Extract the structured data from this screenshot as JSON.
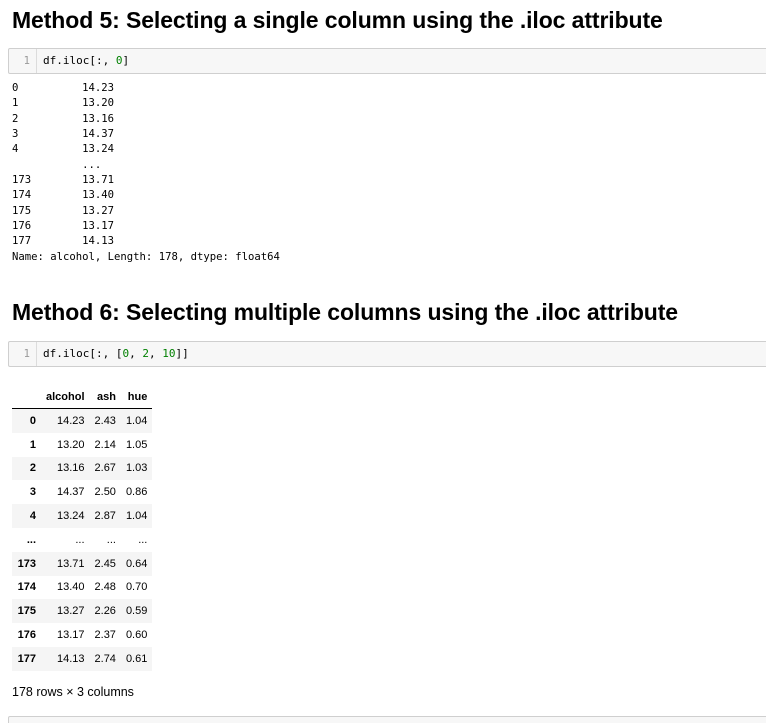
{
  "section5": {
    "title": "Method 5: Selecting a single column using the .iloc attribute",
    "cell": {
      "line_number": "1",
      "code_prefix": "df.iloc[:, ",
      "code_arg": "0",
      "code_suffix": "]"
    },
    "output": {
      "rows": [
        {
          "index": "0",
          "value": "14.23"
        },
        {
          "index": "1",
          "value": "13.20"
        },
        {
          "index": "2",
          "value": "13.16"
        },
        {
          "index": "3",
          "value": "14.37"
        },
        {
          "index": "4",
          "value": "13.24"
        },
        {
          "index": "",
          "value": "..."
        },
        {
          "index": "173",
          "value": "13.71"
        },
        {
          "index": "174",
          "value": "13.40"
        },
        {
          "index": "175",
          "value": "13.27"
        },
        {
          "index": "176",
          "value": "13.17"
        },
        {
          "index": "177",
          "value": "14.13"
        }
      ],
      "footer": "Name: alcohol, Length: 178, dtype: float64"
    }
  },
  "section6": {
    "title": "Method 6: Selecting multiple columns using the .iloc attribute",
    "cell": {
      "line_number": "1",
      "code_prefix": "df.iloc[:, [",
      "arg1": "0",
      "sep1": ", ",
      "arg2": "2",
      "sep2": ", ",
      "arg3": "10",
      "code_suffix": "]]"
    },
    "table": {
      "columns": [
        "alcohol",
        "ash",
        "hue"
      ],
      "rows": [
        {
          "index": "0",
          "alcohol": "14.23",
          "ash": "2.43",
          "hue": "1.04"
        },
        {
          "index": "1",
          "alcohol": "13.20",
          "ash": "2.14",
          "hue": "1.05"
        },
        {
          "index": "2",
          "alcohol": "13.16",
          "ash": "2.67",
          "hue": "1.03"
        },
        {
          "index": "3",
          "alcohol": "14.37",
          "ash": "2.50",
          "hue": "0.86"
        },
        {
          "index": "4",
          "alcohol": "13.24",
          "ash": "2.87",
          "hue": "1.04"
        },
        {
          "index": "...",
          "alcohol": "...",
          "ash": "...",
          "hue": "..."
        },
        {
          "index": "173",
          "alcohol": "13.71",
          "ash": "2.45",
          "hue": "0.64"
        },
        {
          "index": "174",
          "alcohol": "13.40",
          "ash": "2.48",
          "hue": "0.70"
        },
        {
          "index": "175",
          "alcohol": "13.27",
          "ash": "2.26",
          "hue": "0.59"
        },
        {
          "index": "176",
          "alcohol": "13.17",
          "ash": "2.37",
          "hue": "0.60"
        },
        {
          "index": "177",
          "alcohol": "14.13",
          "ash": "2.74",
          "hue": "0.61"
        }
      ],
      "shape": "178 rows × 3 columns"
    }
  },
  "colors": {
    "number_literal": "#008000",
    "cell_background": "#f7f7f7",
    "cell_border": "#cfcfcf"
  }
}
